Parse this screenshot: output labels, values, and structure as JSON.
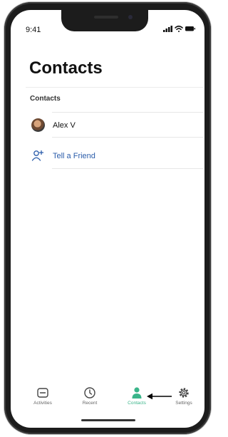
{
  "status_bar": {
    "time": "9:41"
  },
  "page": {
    "title": "Contacts"
  },
  "contacts": {
    "section_header": "Contacts",
    "items": [
      {
        "name": "Alex  V",
        "avatar": "profile-photo"
      }
    ],
    "invite_label": "Tell a Friend",
    "invite_icon": "add-person-icon"
  },
  "tab_bar": {
    "active": "Contacts",
    "active_color": "#3ab58a",
    "tabs": [
      {
        "label": "Activities",
        "icon": "activities-icon"
      },
      {
        "label": "Recent",
        "icon": "clock-icon"
      },
      {
        "label": "Contacts",
        "icon": "person-icon"
      },
      {
        "label": "Settings",
        "icon": "gear-icon"
      }
    ]
  },
  "annotation": {
    "icon": "arrow-left-icon"
  }
}
